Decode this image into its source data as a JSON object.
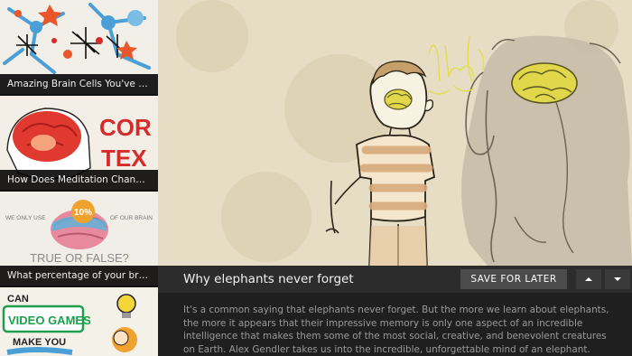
{
  "playlist": {
    "items": [
      {
        "title": "Amazing Brain Cells You've Nev...",
        "thumb_text": ""
      },
      {
        "title": "How Does Meditation Change t...",
        "thumb_text_1": "COR",
        "thumb_text_2": "TEX"
      },
      {
        "title": "What percentage of your brain...",
        "thumb_text_1": "WE ONLY USE",
        "thumb_text_2": "10%",
        "thumb_text_3": "OF OUR BRAIN",
        "thumb_text_4": "TRUE OR FALSE?"
      },
      {
        "title": "",
        "thumb_text_1": "CAN",
        "thumb_text_2": "VIDEO GAMES",
        "thumb_text_3": "MAKE YOU"
      }
    ]
  },
  "video": {
    "title": "Why elephants never forget",
    "save_label": "SAVE FOR LATER",
    "description": "It's a common saying that elephants never forget. But the more we learn about elephants, the more it appears that their impressive memory is only one aspect of an incredible intelligence that makes them some of the most social, creative, and benevolent creatures on Earth. Alex Gendler takes us into the incredible, unforgettable mind of an elephant."
  },
  "colors": {
    "infobar": "#2c2c2c",
    "button": "#4b4b4b",
    "stage_bg": "#e7dcc4",
    "brain_yellow": "#e0d84a"
  },
  "icons": {
    "up": "chevron-up-icon",
    "down": "chevron-down-icon"
  }
}
